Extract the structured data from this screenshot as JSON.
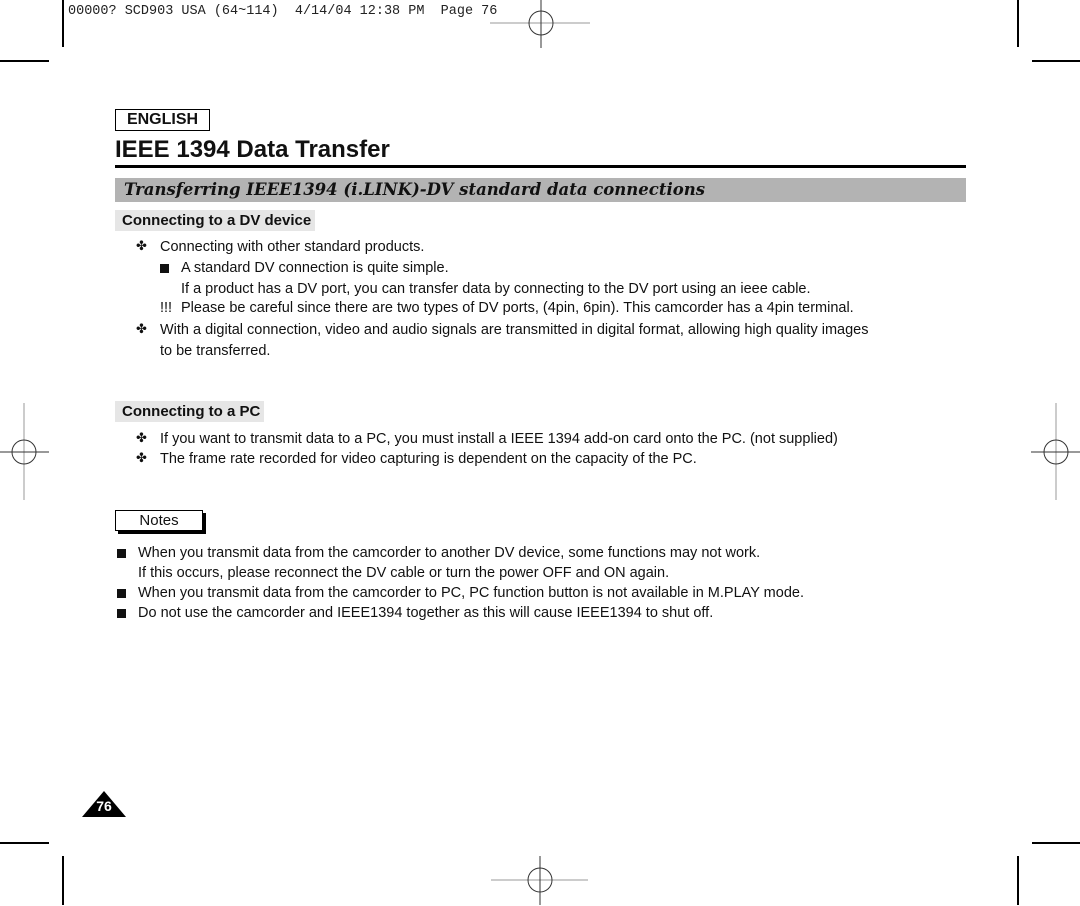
{
  "slug_line": "00000? SCD903 USA (64~114)  4/14/04 12:38 PM  Page 76",
  "language_tab": "ENGLISH",
  "page_title": "IEEE 1394 Data Transfer",
  "section_title": "Transferring IEEE1394 (i.LINK)-DV standard data connections",
  "dv_section": {
    "heading": "Connecting to a DV device",
    "lines": [
      {
        "marker": "✤",
        "text": "Connecting with other standard products."
      },
      {
        "marker": "■",
        "text": "A standard DV connection is quite simple."
      },
      {
        "marker": "",
        "text": "If a product has a DV port, you can transfer data by connecting to the DV port using an ieee cable."
      },
      {
        "marker": "!!!",
        "text": "Please be careful since there are two types of DV ports, (4pin, 6pin). This camcorder has a 4pin terminal."
      },
      {
        "marker": "✤",
        "text": "With a digital connection, video and audio signals are transmitted in digital format, allowing high quality images"
      },
      {
        "marker": "",
        "text": "to be transferred."
      }
    ]
  },
  "pc_section": {
    "heading": "Connecting to a PC",
    "lines": [
      {
        "marker": "✤",
        "text": "If you want to transmit data to a PC, you must install a IEEE 1394 add-on card onto the PC. (not supplied)"
      },
      {
        "marker": "✤",
        "text": "The frame rate recorded for video capturing is dependent on the capacity of the PC."
      }
    ]
  },
  "notes": {
    "label": "Notes",
    "lines": [
      {
        "marker": "■",
        "text": "When you transmit data from the camcorder to another DV device, some functions may not work."
      },
      {
        "marker": "",
        "text": "If this occurs, please reconnect the DV cable or turn the power OFF and ON again."
      },
      {
        "marker": "■",
        "text": "When you transmit data from the camcorder to PC, PC function button is not available in M.PLAY mode."
      },
      {
        "marker": "■",
        "text": "Do not use the camcorder and IEEE1394 together as this will cause IEEE1394 to shut off."
      }
    ]
  },
  "page_number": "76"
}
